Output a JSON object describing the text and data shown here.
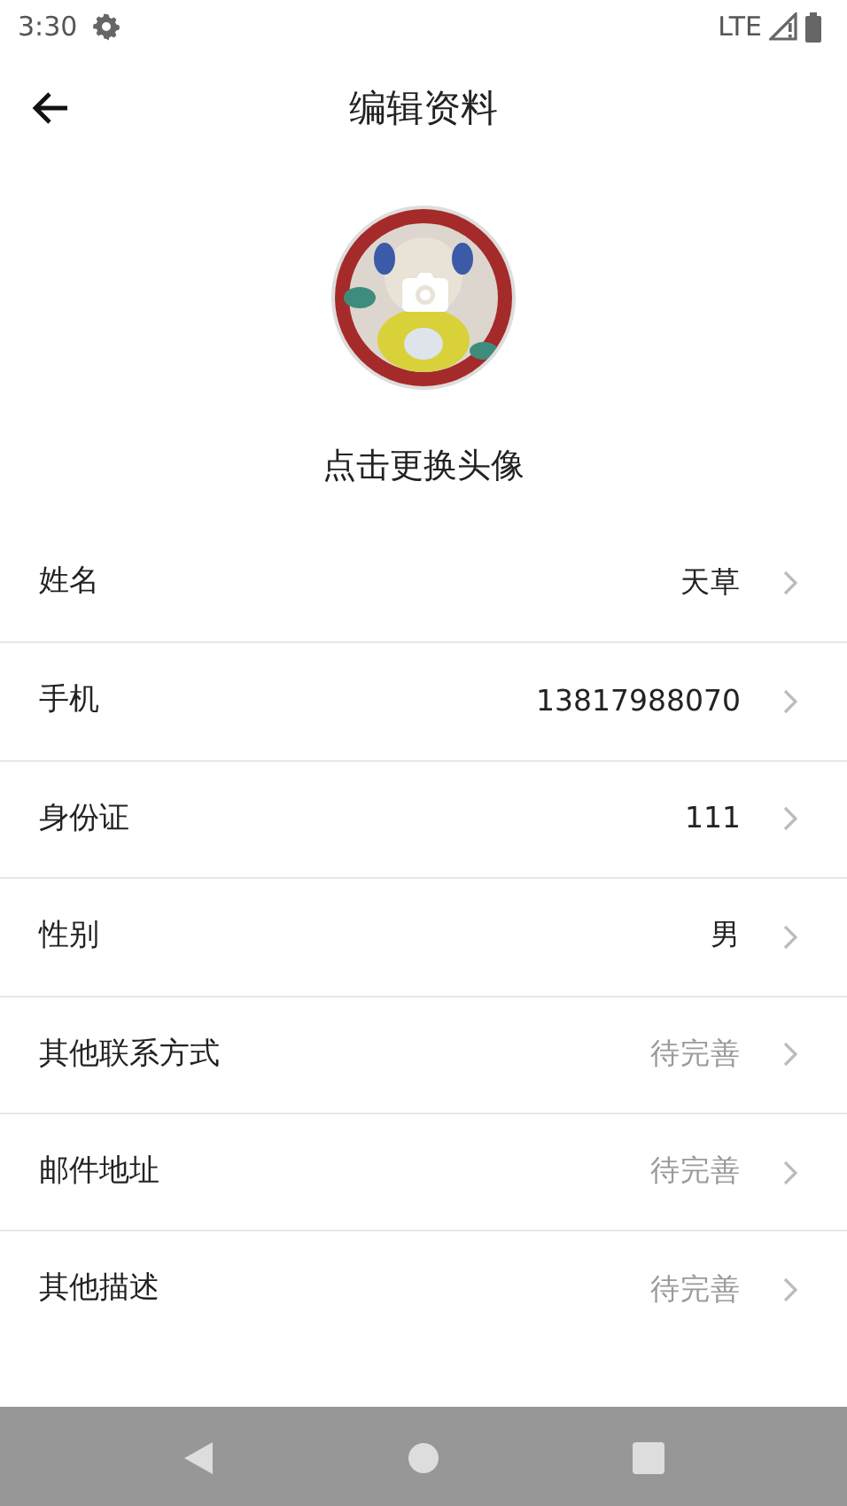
{
  "status_bar": {
    "time": "3:30",
    "network": "LTE"
  },
  "header": {
    "title": "编辑资料"
  },
  "avatar": {
    "caption": "点击更换头像"
  },
  "fields": [
    {
      "label": "姓名",
      "value": "天草"
    },
    {
      "label": "手机",
      "value": "13817988070"
    },
    {
      "label": "身份证",
      "value": "111"
    },
    {
      "label": "性别",
      "value": "男"
    },
    {
      "label": "其他联系方式",
      "placeholder": "待完善"
    },
    {
      "label": "邮件地址",
      "placeholder": "待完善"
    },
    {
      "label": "其他描述",
      "placeholder": "待完善"
    }
  ]
}
